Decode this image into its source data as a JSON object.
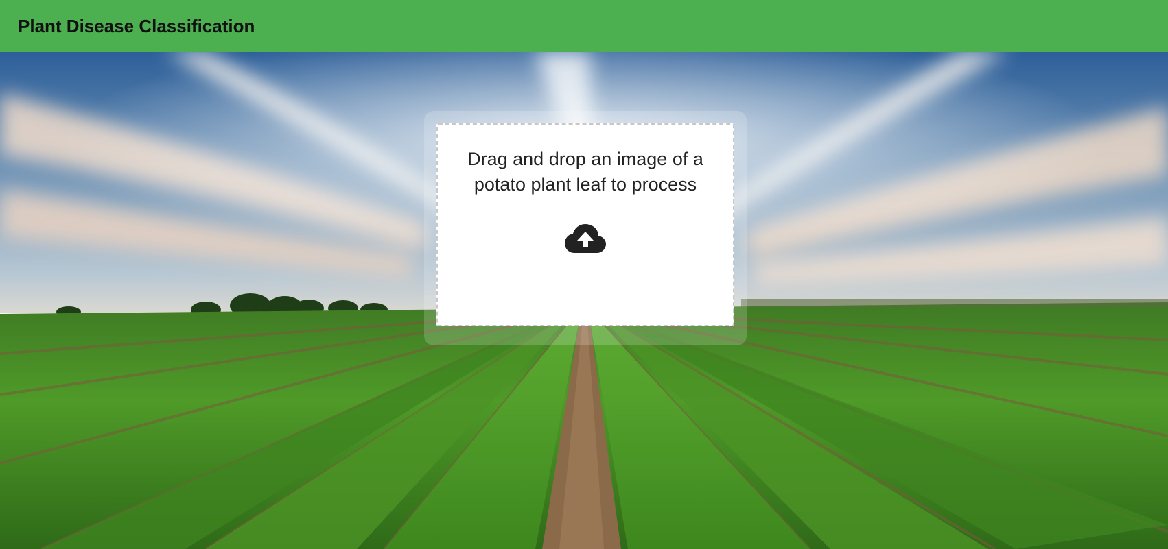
{
  "app": {
    "title": "Plant Disease Classification"
  },
  "dropzone": {
    "instruction": "Drag and drop an image of a potato plant leaf to process",
    "icon": "cloud-upload-icon"
  },
  "colors": {
    "header_bg": "#4caf50",
    "header_text": "#111111",
    "dropzone_bg": "#ffffff",
    "dropzone_border": "#c8c8c8",
    "text": "#222222"
  }
}
